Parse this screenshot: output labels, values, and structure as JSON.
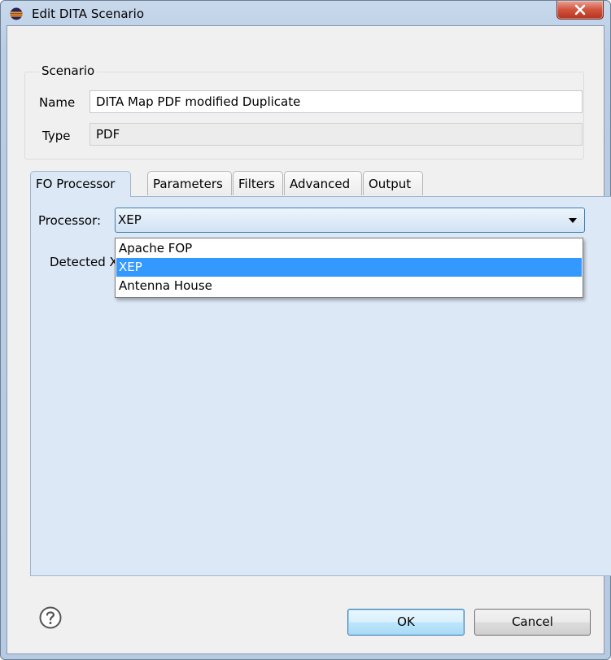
{
  "window": {
    "title": "Edit DITA Scenario"
  },
  "scenario": {
    "legend": "Scenario",
    "name_label": "Name",
    "name_value": "DITA Map PDF modified Duplicate",
    "type_label": "Type",
    "type_value": "PDF"
  },
  "tabs": [
    {
      "label": "FO Processor",
      "active": true
    },
    {
      "label": "Parameters",
      "active": false
    },
    {
      "label": "Filters",
      "active": false
    },
    {
      "label": "Advanced",
      "active": false
    },
    {
      "label": "Output",
      "active": false
    }
  ],
  "processor": {
    "label": "Processor:",
    "selected": "XEP",
    "options": [
      "Apache FOP",
      "XEP",
      "Antenna House"
    ],
    "detected_label": "Detected X"
  },
  "buttons": {
    "ok": "OK",
    "cancel": "Cancel"
  },
  "icons": {
    "help": "help-icon",
    "close": "close-icon",
    "app": "eclipse-icon"
  },
  "colors": {
    "selection": "#3399ff",
    "tab_active_bg": "#dce8f5"
  }
}
